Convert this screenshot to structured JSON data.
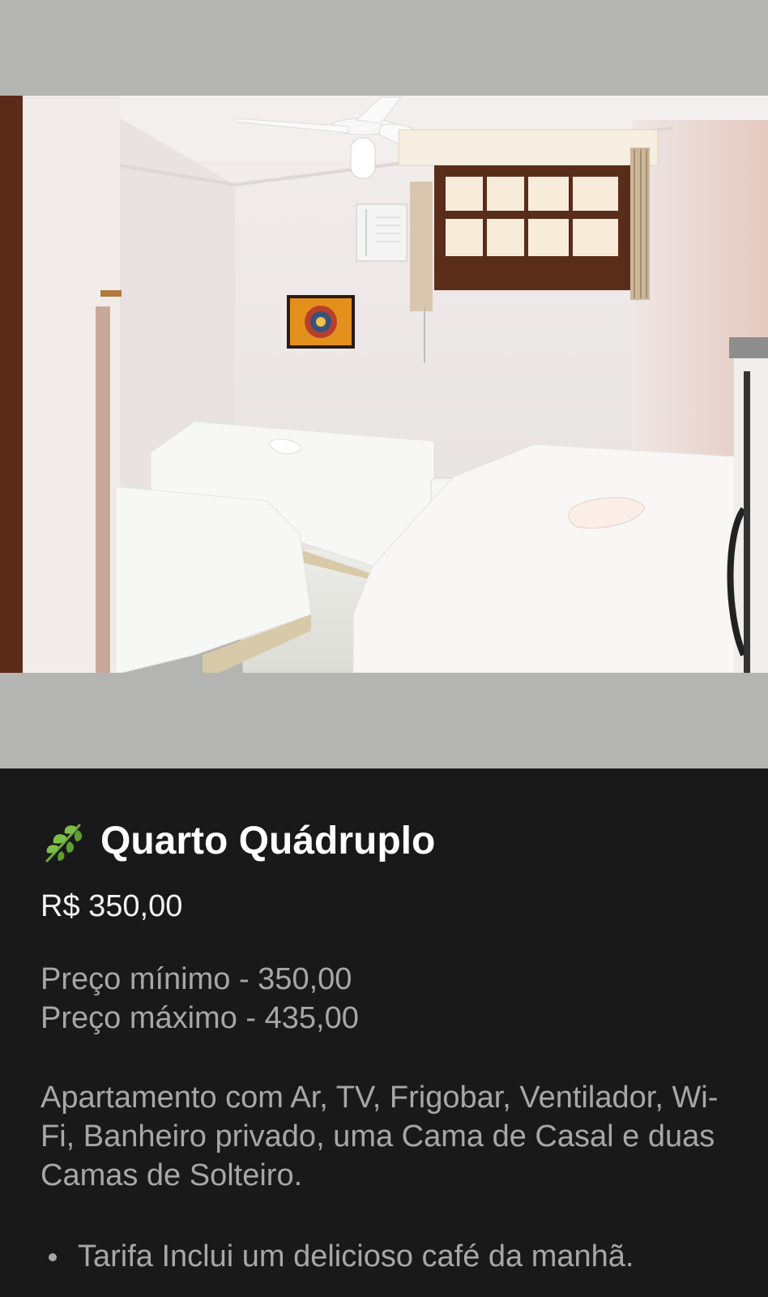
{
  "photo": {
    "icon": "room-photo"
  },
  "room": {
    "icon": "herb-leaf-icon",
    "title": "Quarto Quádruplo",
    "price": "R$ 350,00",
    "min_price": "Preço mínimo - 350,00",
    "max_price": "Preço máximo - 435,00",
    "description": "Apartamento com Ar, TV, Frigobar, Ventilador, Wi-Fi, Banheiro privado, uma Cama de Casal e duas Camas de Solteiro.",
    "bullets": [
      "Tarifa Inclui um delicioso café da manhã."
    ]
  }
}
